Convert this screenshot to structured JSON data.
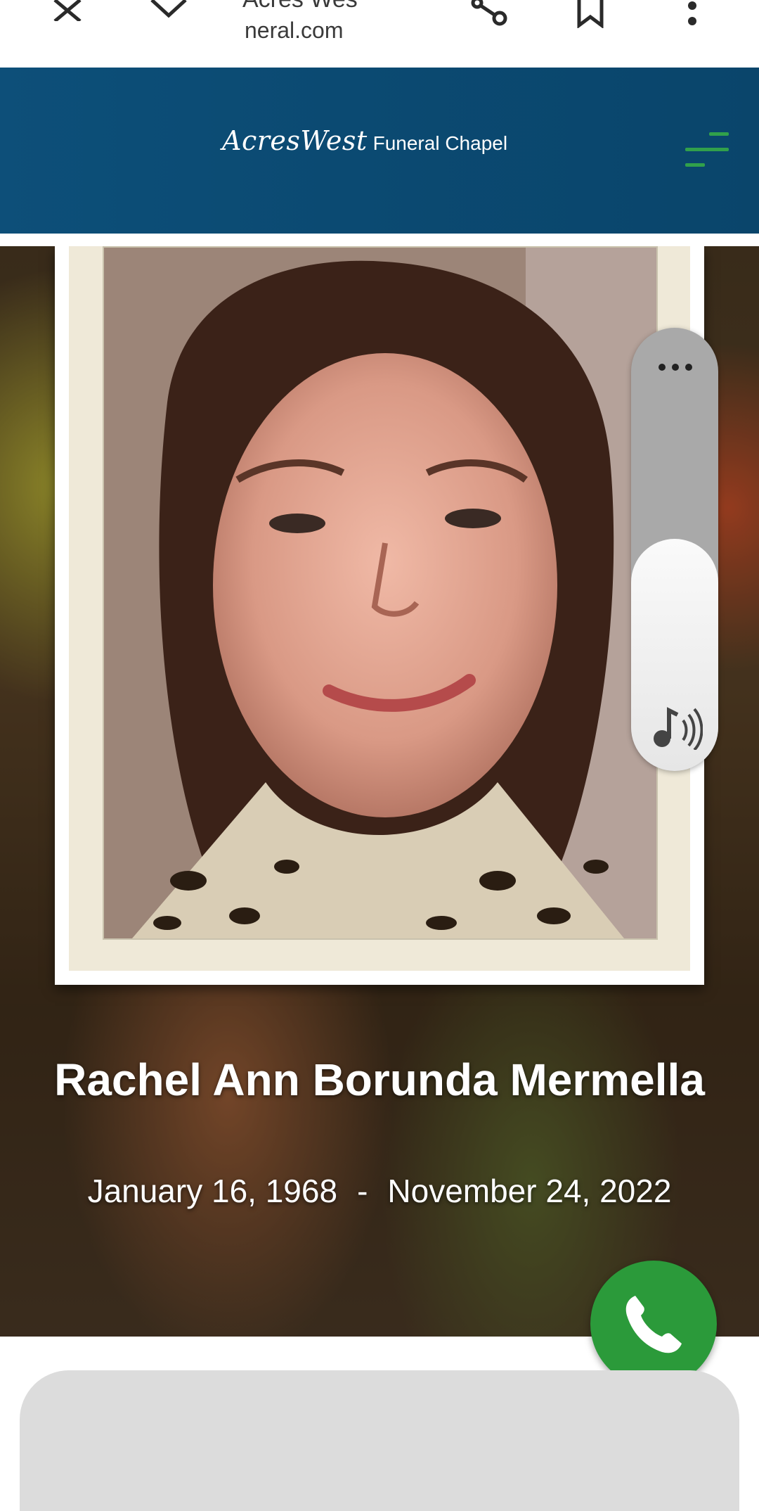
{
  "browser": {
    "title": "Acres Wes",
    "url": "neral.com"
  },
  "site": {
    "brand_script": "AcresWest",
    "brand_rest": "Funeral Chapel"
  },
  "obituary": {
    "name": "Rachel Ann Borunda Mermella",
    "birth_date": "January 16, 1968",
    "separator": "-",
    "death_date": "November 24, 2022"
  },
  "icons": {
    "close": "close-icon",
    "tag": "tag-icon",
    "share": "share-icon",
    "bookmark": "bookmark-icon",
    "more": "more-vert-icon",
    "menu": "hamburger-icon",
    "volume": "volume-icon",
    "phone": "phone-icon"
  },
  "colors": {
    "header_blue": "#0b4a72",
    "accent_green": "#31a04b",
    "call_green": "#2b9a3a"
  }
}
